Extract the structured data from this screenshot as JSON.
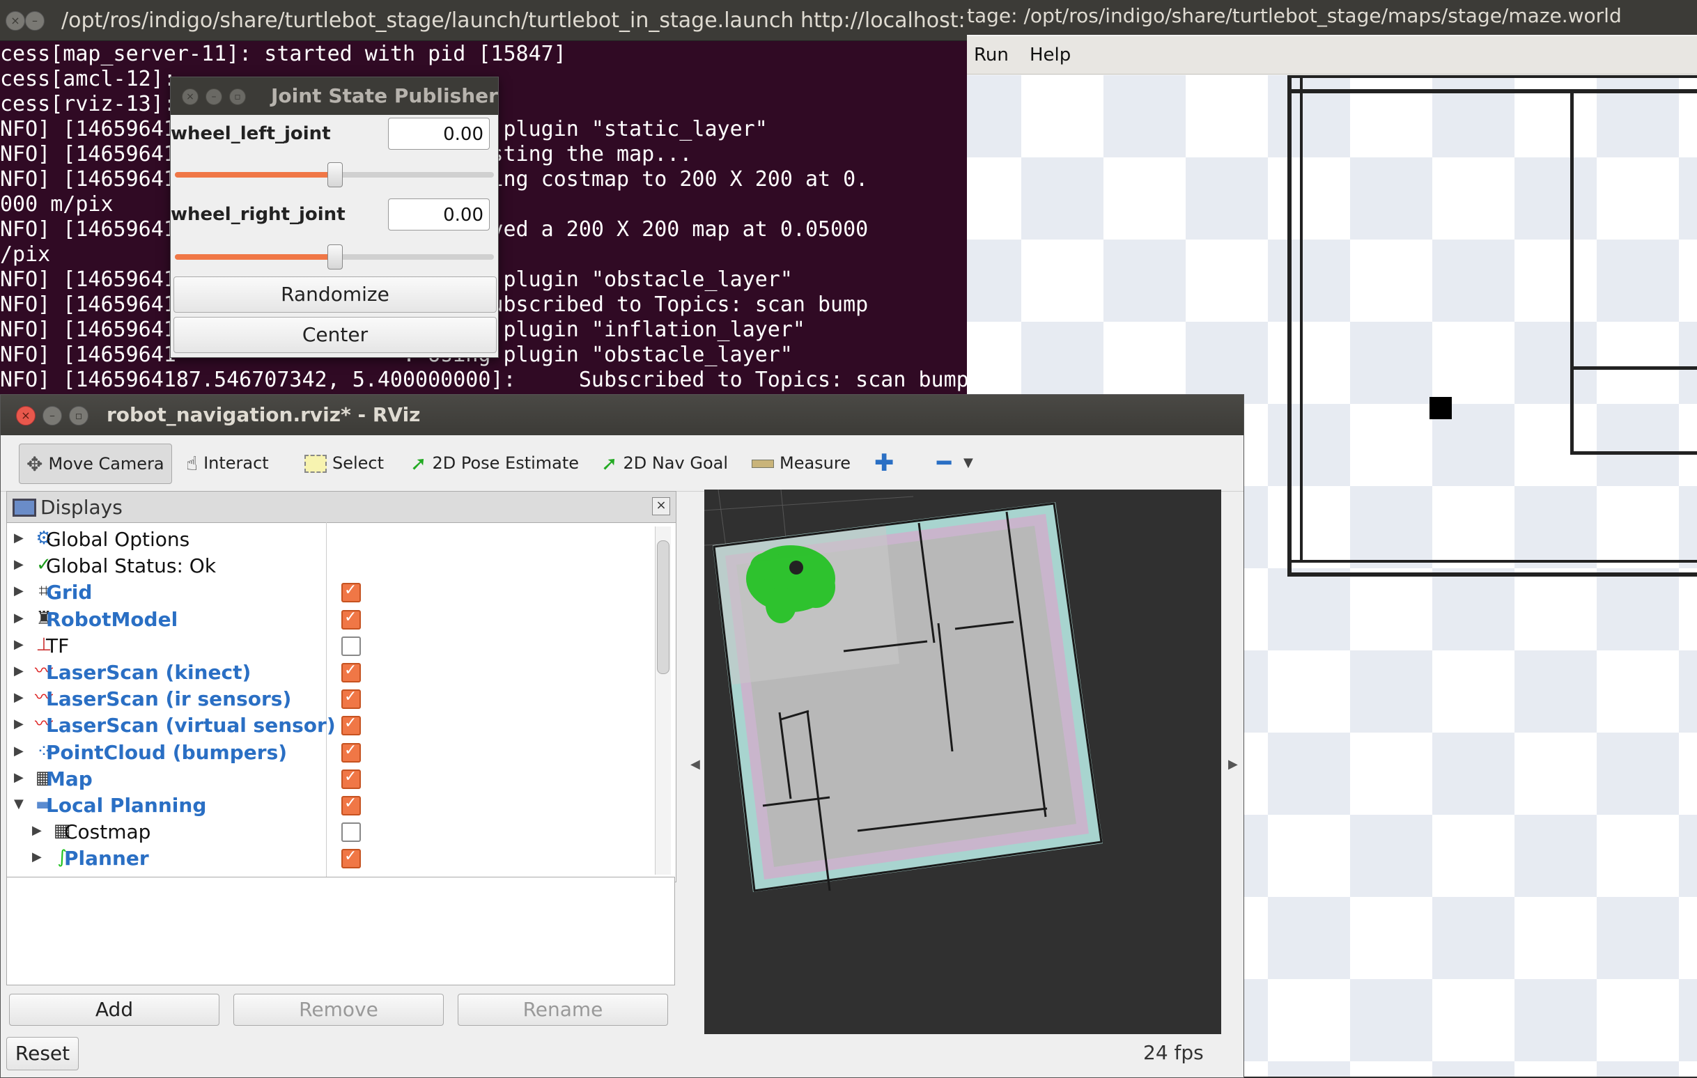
{
  "terminal": {
    "title": "/opt/ros/indigo/share/turtlebot_stage/launch/turtlebot_in_stage.launch http://localhost:",
    "lines": [
      "cess[map_server-11]: started with pid [15847]",
      "cess[amcl-12]:",
      "cess[rviz-13]:",
      "NFO] [14659641                  : Using plugin \"static_layer\"",
      "NFO] [14659641                  : Requesting the map...",
      "NFO] [14659641                  : Resizing costmap to 200 X 200 at 0.",
      "000 m/pix",
      "NFO] [14659641                  : Received a 200 X 200 map at 0.05000",
      "/pix",
      "NFO] [14659641                  : Using plugin \"obstacle_layer\"",
      "NFO] [14659641                  :     Subscribed to Topics: scan bump",
      "NFO] [14659641                  : Using plugin \"inflation_layer\"",
      "NFO] [14659641                  : Using plugin \"obstacle_layer\"",
      "NFO] [1465964187.546707342, 5.400000000]:     Subscribed to Topics: scan bump"
    ]
  },
  "stage": {
    "title": "tage: /opt/ros/indigo/share/turtlebot_stage/maps/stage/maze.world",
    "menu": [
      "Run",
      "Help"
    ]
  },
  "jsp": {
    "title": "Joint State Publisher",
    "joints": [
      {
        "name": "wheel_left_joint",
        "value": "0.00",
        "fraction": 0.5
      },
      {
        "name": "wheel_right_joint",
        "value": "0.00",
        "fraction": 0.5
      }
    ],
    "randomize_label": "Randomize",
    "center_label": "Center"
  },
  "rviz": {
    "title": "robot_navigation.rviz* - RViz",
    "tools": [
      {
        "label": "Move Camera",
        "icon": "move-camera-icon",
        "active": true
      },
      {
        "label": "Interact",
        "icon": "hand-icon"
      },
      {
        "label": "Select",
        "icon": "select-icon"
      },
      {
        "label": "2D Pose Estimate",
        "icon": "green-arrow-icon"
      },
      {
        "label": "2D Nav Goal",
        "icon": "green-arrow-icon"
      },
      {
        "label": "Measure",
        "icon": "ruler-icon"
      }
    ],
    "displays": {
      "title": "Displays",
      "items": [
        {
          "label": "Global Options",
          "style": "dark",
          "checked": null,
          "icon": "gear-icon"
        },
        {
          "label": "Global Status: Ok",
          "style": "dark",
          "checked": null,
          "icon": "check-icon"
        },
        {
          "label": "Grid",
          "style": "blue",
          "checked": true,
          "icon": "grid-icon"
        },
        {
          "label": "RobotModel",
          "style": "blue",
          "checked": true,
          "icon": "robot-icon"
        },
        {
          "label": "TF",
          "style": "dark",
          "checked": false,
          "icon": "axes-icon"
        },
        {
          "label": "LaserScan (kinect)",
          "style": "blue",
          "checked": true,
          "icon": "laser-icon"
        },
        {
          "label": "LaserScan (ir sensors)",
          "style": "blue",
          "checked": true,
          "icon": "laser-icon"
        },
        {
          "label": "LaserScan (virtual sensor)",
          "style": "blue",
          "checked": true,
          "icon": "laser-icon"
        },
        {
          "label": "PointCloud (bumpers)",
          "style": "blue",
          "checked": true,
          "icon": "pointcloud-icon"
        },
        {
          "label": "Map",
          "style": "blue",
          "checked": true,
          "icon": "map-icon"
        },
        {
          "label": "Local Planning",
          "style": "blue",
          "checked": true,
          "icon": "folder-icon",
          "expanded": true
        },
        {
          "label": "Costmap",
          "style": "dark",
          "checked": false,
          "icon": "map-icon",
          "child": true
        },
        {
          "label": "Planner",
          "style": "blue",
          "checked": true,
          "icon": "path-icon",
          "child": true
        }
      ]
    },
    "buttons": {
      "add": "Add",
      "remove": "Remove",
      "rename": "Rename",
      "reset": "Reset"
    },
    "fps": "24 fps"
  },
  "colors": {
    "terminal_bg": "#300a24",
    "accent_orange": "#f07746",
    "display_blue": "#2a6fc4",
    "laser_green": "#1ec21e"
  }
}
